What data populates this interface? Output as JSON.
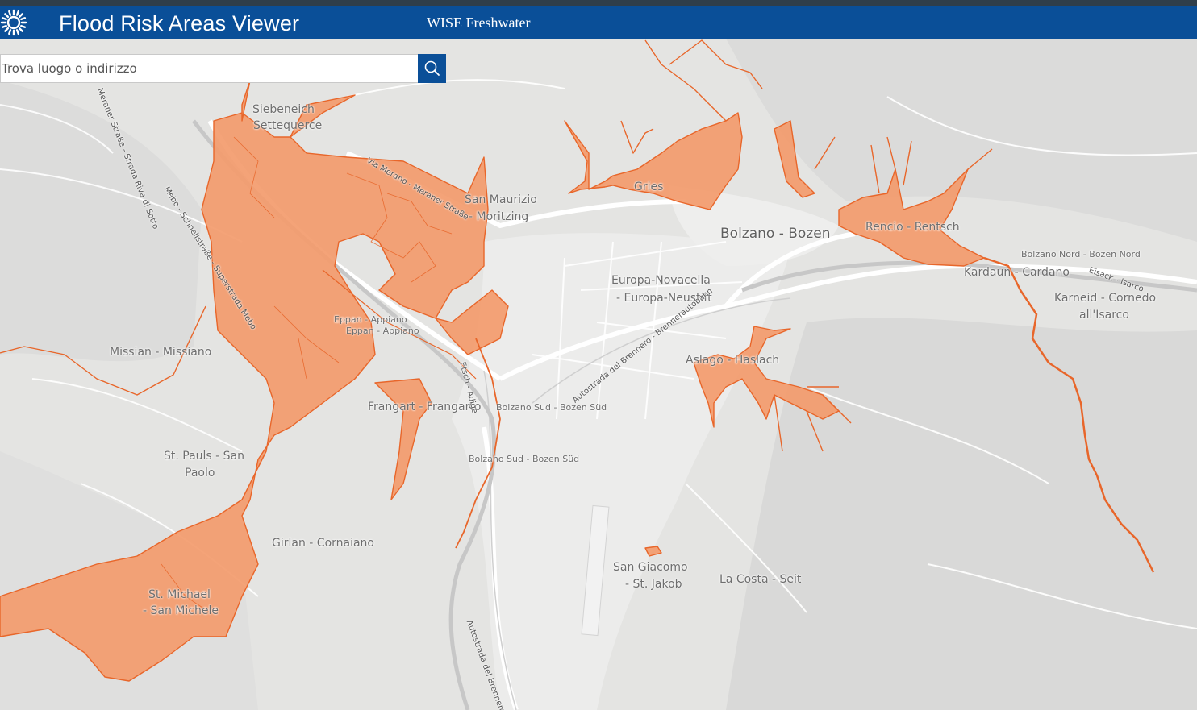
{
  "header": {
    "title": "Flood Risk Areas Viewer",
    "subtitle": "WISE Freshwater",
    "logo_icon": "sun-logo-icon"
  },
  "search": {
    "placeholder": "Trova luogo o indirizzo",
    "value": "",
    "button_icon": "search-icon"
  },
  "colors": {
    "header_bg": "#0a4f98",
    "flood_area": "#f39b6d",
    "flood_outline": "#e8662a",
    "basemap": "#e4e4e2"
  },
  "map": {
    "place_labels": [
      {
        "id": "siebeneich-1",
        "text": "Siebeneich"
      },
      {
        "id": "siebeneich-2",
        "text": "Settequerce"
      },
      {
        "id": "smaurizio-1",
        "text": "San Maurizio"
      },
      {
        "id": "smaurizio-2",
        "text": "- Moritzing"
      },
      {
        "id": "gries",
        "text": "Gries"
      },
      {
        "id": "bolzano",
        "text": "Bolzano - Bozen"
      },
      {
        "id": "rencio",
        "text": "Rencio - Rentsch"
      },
      {
        "id": "bz-nord",
        "text": "Bolzano Nord - Bozen Nord"
      },
      {
        "id": "kardaun",
        "text": "Kardaun - Cardano"
      },
      {
        "id": "karneid-1",
        "text": "Karneid - Cornedo"
      },
      {
        "id": "karneid-2",
        "text": "all'Isarco"
      },
      {
        "id": "europa-1",
        "text": "Europa-Novacella"
      },
      {
        "id": "europa-2",
        "text": "- Europa-Neustift"
      },
      {
        "id": "eppan-1",
        "text": "Eppan - Appiano"
      },
      {
        "id": "eppan-2",
        "text": "Eppan - Appiano"
      },
      {
        "id": "missian",
        "text": "Missian - Missiano"
      },
      {
        "id": "aslago",
        "text": "Aslago - Haslach"
      },
      {
        "id": "frangart",
        "text": "Frangart - Frangarto"
      },
      {
        "id": "bz-sud-1",
        "text": "Bolzano Sud - Bozen Süd"
      },
      {
        "id": "bz-sud-2",
        "text": "Bolzano Sud - Bozen Süd"
      },
      {
        "id": "stpauls-1",
        "text": "St. Pauls - San"
      },
      {
        "id": "stpauls-2",
        "text": "Paolo"
      },
      {
        "id": "girlan",
        "text": "Girlan - Cornaiano"
      },
      {
        "id": "stmichael-1",
        "text": "St. Michael"
      },
      {
        "id": "stmichael-2",
        "text": "- San Michele"
      },
      {
        "id": "sgiacomo-1",
        "text": "San Giacomo"
      },
      {
        "id": "sgiacomo-2",
        "text": "- St. Jakob"
      },
      {
        "id": "lacosta",
        "text": "La Costa - Seit"
      }
    ],
    "road_labels": [
      {
        "id": "mebo",
        "text": "Mebo - Schnellstraße - Superstrada Mebo"
      },
      {
        "id": "viamerano",
        "text": "Via Merano - Meraner Straße"
      },
      {
        "id": "a22",
        "text": "Autostrada del Brennero - Brennerautobahn"
      },
      {
        "id": "a22-south",
        "text": "Autostrada del Brennero - B"
      },
      {
        "id": "strada",
        "text": "Meraner Straße - Strada Riva di Sotto"
      },
      {
        "id": "etsch",
        "text": "Etsch - Adige"
      },
      {
        "id": "isarco",
        "text": "Eisack - Isarco"
      }
    ]
  }
}
